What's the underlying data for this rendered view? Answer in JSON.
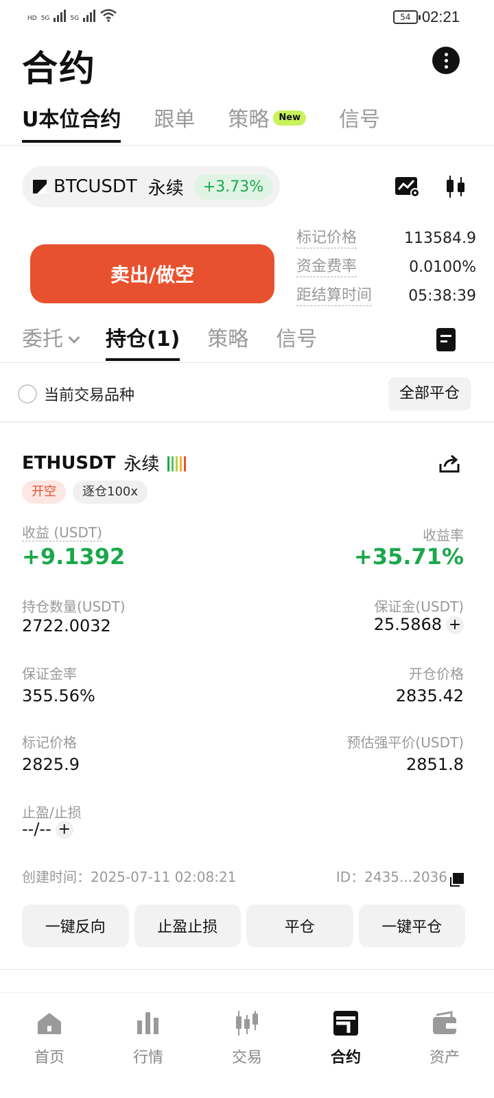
{
  "status_bar": {
    "net_small_1": "HD",
    "net_small_2": "5G",
    "net_small_3": "5G",
    "battery": "54",
    "time": "02:21"
  },
  "page": {
    "title": "合约"
  },
  "top_tabs": [
    {
      "label": "U本位合约",
      "active": true
    },
    {
      "label": "跟单",
      "active": false
    },
    {
      "label": "策略",
      "active": false,
      "badge": "New"
    },
    {
      "label": "信号",
      "active": false
    }
  ],
  "pair": {
    "symbol": "BTCUSDT",
    "type": "永续",
    "change": "+3.73%",
    "change_color": "#1aa84b"
  },
  "sell_button": {
    "label": "卖出/做空",
    "color": "#e8512f"
  },
  "market_info": [
    {
      "label": "标记价格",
      "value": "113584.9"
    },
    {
      "label": "资金费率",
      "value": "0.0100%"
    },
    {
      "label": "距结算时间",
      "value": "05:38:39"
    }
  ],
  "sub_tabs": [
    {
      "label": "委托",
      "active": false
    },
    {
      "label": "持仓(1)",
      "active": true
    },
    {
      "label": "策略",
      "active": false
    },
    {
      "label": "信号",
      "active": false
    }
  ],
  "filter": {
    "label": "当前交易品种",
    "close_all": "全部平仓"
  },
  "position": {
    "symbol": "ETHUSDT",
    "type": "永续",
    "tag_side": "开空",
    "tag_margin": "逐仓100x",
    "pnl_label": "收益 (USDT)",
    "pnl_value": "+9.1392",
    "roe_label": "收益率",
    "roe_value": "+35.71%",
    "size_label": "持仓数量(USDT)",
    "size_value": "2722.0032",
    "margin_label": "保证金(USDT)",
    "margin_value": "25.5868",
    "margin_ratio_label": "保证金率",
    "margin_ratio_value": "355.56%",
    "entry_label": "开仓价格",
    "entry_value": "2835.42",
    "mark_label": "标记价格",
    "mark_value": "2825.9",
    "liq_label": "预估强平价(USDT)",
    "liq_value": "2851.8",
    "tpsl_label": "止盈/止损",
    "tpsl_value": "--/--",
    "created": "创建时间：2025-07-11 02:08:21",
    "id": "ID：2435...2036"
  },
  "actions": [
    {
      "label": "一键反向"
    },
    {
      "label": "止盈止损"
    },
    {
      "label": "平仓"
    },
    {
      "label": "一键平仓"
    }
  ],
  "bottom_nav": [
    {
      "label": "首页",
      "icon": "home-icon",
      "active": false
    },
    {
      "label": "行情",
      "icon": "market-chart-icon",
      "active": false
    },
    {
      "label": "交易",
      "icon": "trade-candles-icon",
      "active": false
    },
    {
      "label": "合约",
      "icon": "futures-icon",
      "active": true
    },
    {
      "label": "资产",
      "icon": "wallet-icon",
      "active": false
    }
  ]
}
